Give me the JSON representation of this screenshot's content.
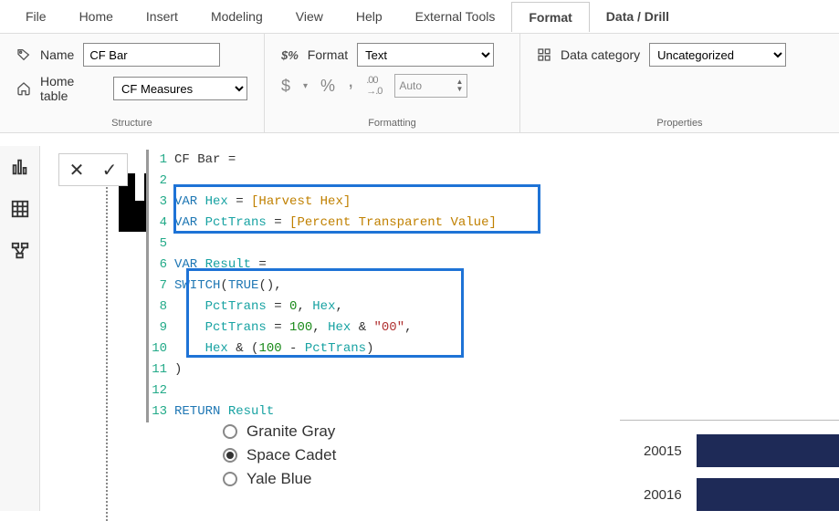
{
  "menu": {
    "items": [
      "File",
      "Home",
      "Insert",
      "Modeling",
      "View",
      "Help",
      "External Tools",
      "Format",
      "Data / Drill"
    ],
    "active_index": 7
  },
  "ribbon": {
    "structure": {
      "name_label": "Name",
      "name_value": "CF Bar",
      "table_label": "Home table",
      "table_value": "CF Measures",
      "group_label": "Structure"
    },
    "formatting": {
      "format_label": "Format",
      "format_value": "Text",
      "currency_symbol": "$",
      "percent_symbol": "%",
      "comma_symbol": ",",
      "decimal_symbol": ".00→.0",
      "auto_label": "Auto",
      "group_label": "Formatting"
    },
    "properties": {
      "category_label": "Data category",
      "category_value": "Uncategorized",
      "group_label": "Properties"
    }
  },
  "editor": {
    "lines": [
      {
        "n": 1,
        "tokens": [
          {
            "t": "CF Bar ",
            "c": ""
          },
          {
            "t": "=",
            "c": ""
          }
        ]
      },
      {
        "n": 2,
        "tokens": []
      },
      {
        "n": 3,
        "tokens": [
          {
            "t": "VAR ",
            "c": "kw"
          },
          {
            "t": "Hex ",
            "c": "var"
          },
          {
            "t": "= ",
            "c": ""
          },
          {
            "t": "[Harvest Hex]",
            "c": "bracket"
          }
        ]
      },
      {
        "n": 4,
        "tokens": [
          {
            "t": "VAR ",
            "c": "kw"
          },
          {
            "t": "PctTrans ",
            "c": "var"
          },
          {
            "t": "= ",
            "c": ""
          },
          {
            "t": "[Percent Transparent Value]",
            "c": "bracket"
          }
        ]
      },
      {
        "n": 5,
        "tokens": []
      },
      {
        "n": 6,
        "tokens": [
          {
            "t": "VAR ",
            "c": "kw"
          },
          {
            "t": "Result ",
            "c": "var"
          },
          {
            "t": "=",
            "c": ""
          }
        ]
      },
      {
        "n": 7,
        "tokens": [
          {
            "t": "SWITCH",
            "c": "func"
          },
          {
            "t": "(",
            "c": ""
          },
          {
            "t": "TRUE",
            "c": "func"
          },
          {
            "t": "(),",
            "c": ""
          }
        ]
      },
      {
        "n": 8,
        "tokens": [
          {
            "t": "    ",
            "c": ""
          },
          {
            "t": "PctTrans ",
            "c": "var"
          },
          {
            "t": "= ",
            "c": ""
          },
          {
            "t": "0",
            "c": "num"
          },
          {
            "t": ", ",
            "c": ""
          },
          {
            "t": "Hex",
            "c": "var"
          },
          {
            "t": ",",
            "c": ""
          }
        ]
      },
      {
        "n": 9,
        "tokens": [
          {
            "t": "    ",
            "c": ""
          },
          {
            "t": "PctTrans ",
            "c": "var"
          },
          {
            "t": "= ",
            "c": ""
          },
          {
            "t": "100",
            "c": "num"
          },
          {
            "t": ", ",
            "c": ""
          },
          {
            "t": "Hex ",
            "c": "var"
          },
          {
            "t": "& ",
            "c": ""
          },
          {
            "t": "\"00\"",
            "c": "str"
          },
          {
            "t": ",",
            "c": ""
          }
        ]
      },
      {
        "n": 10,
        "tokens": [
          {
            "t": "    ",
            "c": ""
          },
          {
            "t": "Hex ",
            "c": "var"
          },
          {
            "t": "& (",
            "c": ""
          },
          {
            "t": "100",
            "c": "num"
          },
          {
            "t": " - ",
            "c": ""
          },
          {
            "t": "PctTrans",
            "c": "var"
          },
          {
            "t": ")",
            "c": ""
          }
        ]
      },
      {
        "n": 11,
        "tokens": [
          {
            "t": ")",
            "c": ""
          }
        ]
      },
      {
        "n": 12,
        "tokens": []
      },
      {
        "n": 13,
        "tokens": [
          {
            "t": "RETURN ",
            "c": "kw"
          },
          {
            "t": "Result",
            "c": "var"
          }
        ]
      }
    ]
  },
  "radios": {
    "items": [
      {
        "label": "Granite Gray",
        "checked": false
      },
      {
        "label": "Space Cadet",
        "checked": true
      },
      {
        "label": "Yale Blue",
        "checked": false
      }
    ]
  },
  "bars": {
    "rows": [
      {
        "label": "20015"
      },
      {
        "label": "20016"
      }
    ]
  },
  "confirm": {
    "cancel": "✕",
    "accept": "✓"
  }
}
